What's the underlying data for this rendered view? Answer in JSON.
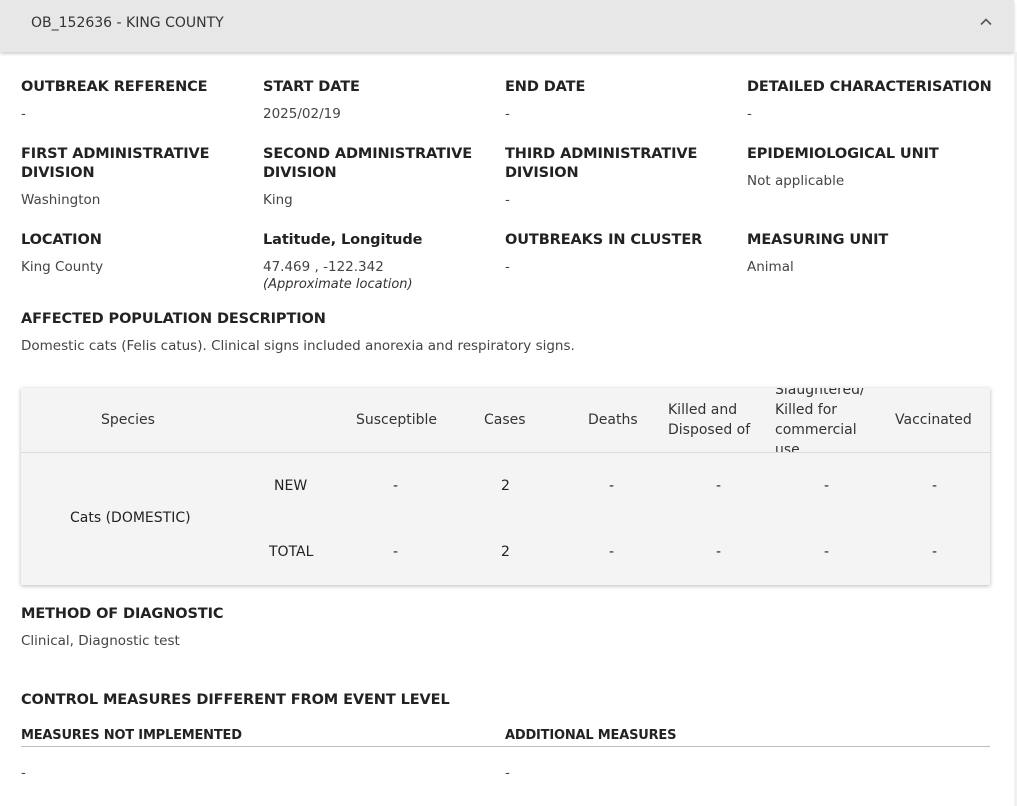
{
  "header": {
    "title": "OB_152636 - KING COUNTY"
  },
  "fields": {
    "outbreak_reference": {
      "label": "OUTBREAK REFERENCE",
      "value": "-"
    },
    "start_date": {
      "label": "START DATE",
      "value": "2025/02/19"
    },
    "end_date": {
      "label": "END DATE",
      "value": "-"
    },
    "detailed_characterisation": {
      "label": "DETAILED CHARACTERISATION",
      "value": "-"
    },
    "first_admin": {
      "label": "FIRST ADMINISTRATIVE DIVISION",
      "value": "Washington"
    },
    "second_admin": {
      "label": "SECOND ADMINISTRATIVE DIVISION",
      "value": "King"
    },
    "third_admin": {
      "label": "THIRD ADMINISTRATIVE DIVISION",
      "value": "-"
    },
    "epi_unit": {
      "label": "EPIDEMIOLOGICAL UNIT",
      "value": "Not applicable"
    },
    "location": {
      "label": "LOCATION",
      "value": "King County"
    },
    "lat_long": {
      "label": "Latitude, Longitude",
      "value": "47.469 , -122.342",
      "note": "(Approximate location)"
    },
    "outbreaks_cluster": {
      "label": "OUTBREAKS IN CLUSTER",
      "value": "-"
    },
    "measuring_unit": {
      "label": "MEASURING UNIT",
      "value": "Animal"
    }
  },
  "affected_population": {
    "label": "AFFECTED POPULATION DESCRIPTION",
    "value": "Domestic cats (Felis catus). Clinical signs included anorexia and respiratory signs."
  },
  "table": {
    "headers": {
      "species": "Species",
      "susceptible": "Susceptible",
      "cases": "Cases",
      "deaths": "Deaths",
      "killed": "Killed and Disposed of",
      "slaughtered": "Slaughtered/ Killed for commercial use",
      "vaccinated": "Vaccinated"
    },
    "species": "Cats (DOMESTIC)",
    "rows": [
      {
        "type": "NEW",
        "susceptible": "-",
        "cases": "2",
        "deaths": "-",
        "killed": "-",
        "slaughtered": "-",
        "vaccinated": "-"
      },
      {
        "type": "TOTAL",
        "susceptible": "-",
        "cases": "2",
        "deaths": "-",
        "killed": "-",
        "slaughtered": "-",
        "vaccinated": "-"
      }
    ]
  },
  "diagnostic": {
    "label": "METHOD OF DIAGNOSTIC",
    "value": "Clinical, Diagnostic test"
  },
  "control": {
    "title": "CONTROL MEASURES DIFFERENT FROM EVENT LEVEL",
    "not_implemented_label": "MEASURES NOT IMPLEMENTED",
    "not_implemented_value": "-",
    "additional_label": "ADDITIONAL MEASURES",
    "additional_value": "-"
  }
}
